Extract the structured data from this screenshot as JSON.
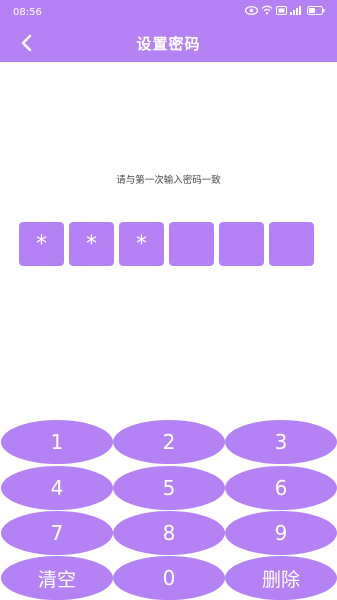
{
  "status_bar": {
    "time": "08:56",
    "icons": [
      "eye-icon",
      "wifi-icon",
      "hd-icon",
      "signal-icon",
      "battery-icon"
    ]
  },
  "header": {
    "title": "设置密码",
    "back_icon": "chevron-left-icon"
  },
  "prompt": "请与第一次输入密码一致",
  "pin": {
    "length": 6,
    "filled_count": 3,
    "mask_char": "*",
    "cells": [
      "*",
      "*",
      "*",
      "",
      "",
      ""
    ]
  },
  "keypad": {
    "k1": "1",
    "k2": "2",
    "k3": "3",
    "k4": "4",
    "k5": "5",
    "k6": "6",
    "k7": "7",
    "k8": "8",
    "k9": "9",
    "clear": "清空",
    "k0": "0",
    "delete": "删除"
  },
  "colors": {
    "accent": "#b582f5",
    "text_on_accent": "#ffffff",
    "background": "#ffffff"
  }
}
